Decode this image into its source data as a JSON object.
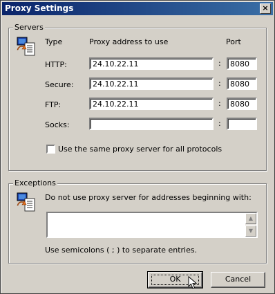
{
  "window": {
    "title": "Proxy Settings",
    "close_label": "×"
  },
  "servers": {
    "group_label": "Servers",
    "col_type": "Type",
    "col_address": "Proxy address to use",
    "col_port": "Port",
    "separator": ":",
    "rows": [
      {
        "type": "HTTP:",
        "address": "24.10.22.11",
        "port": "8080"
      },
      {
        "type": "Secure:",
        "address": "24.10.22.11",
        "port": "8080"
      },
      {
        "type": "FTP:",
        "address": "24.10.22.11",
        "port": "8080"
      },
      {
        "type": "Socks:",
        "address": "",
        "port": ""
      }
    ],
    "same_proxy_label": "Use the same proxy server for all protocols",
    "same_proxy_checked": false
  },
  "exceptions": {
    "group_label": "Exceptions",
    "instruction": "Do not use proxy server for addresses beginning with:",
    "value": "",
    "hint": "Use semicolons ( ; ) to separate entries."
  },
  "buttons": {
    "ok": "OK",
    "cancel": "Cancel"
  },
  "icons": {
    "servers_icon": "network-computer-icon",
    "exceptions_icon": "network-computer-icon"
  },
  "colors": {
    "title_start": "#0a246a",
    "title_end": "#3a6ea5",
    "face": "#d4d0c8"
  }
}
